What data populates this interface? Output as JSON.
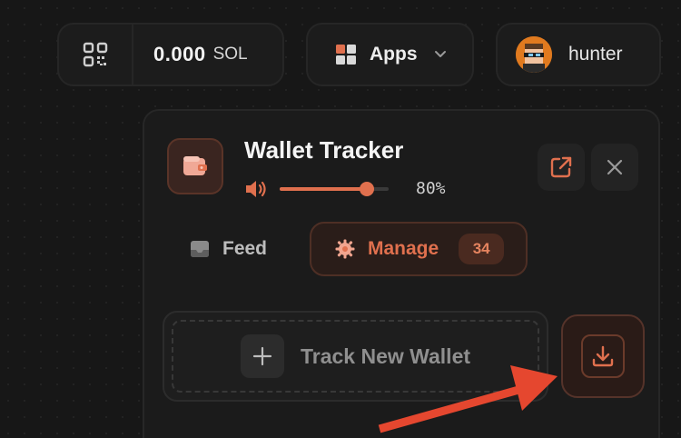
{
  "topbar": {
    "wallet": {
      "qr_icon": "qr-code-icon",
      "balance": "0.000",
      "unit": "SOL"
    },
    "apps": {
      "icon": "grid-icon",
      "label": "Apps",
      "chevron_icon": "chevron-down-icon"
    },
    "user": {
      "avatar": "pixel-avatar",
      "name": "hunter"
    }
  },
  "panel": {
    "icon": "wallet-icon",
    "title": "Wallet Tracker",
    "volume": {
      "icon": "volume-icon",
      "level": 0.8,
      "label": "80%"
    },
    "actions": {
      "open_external_icon": "external-link-icon",
      "close_icon": "close-icon"
    },
    "tabs": [
      {
        "icon": "inbox-icon",
        "label": "Feed",
        "active": false
      },
      {
        "icon": "gear-icon",
        "label": "Manage",
        "active": true,
        "count": "34"
      }
    ],
    "track": {
      "plus_icon": "plus-icon",
      "label": "Track New Wallet"
    },
    "download_icon": "download-icon"
  },
  "colors": {
    "background": "#171717",
    "accent": "#e0704e",
    "annotation_arrow": "#e5472f"
  }
}
